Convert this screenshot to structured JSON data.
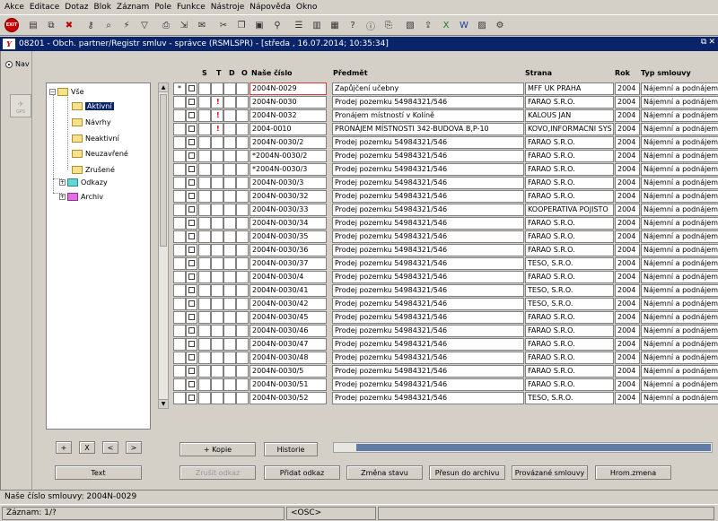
{
  "menu": [
    "Akce",
    "Editace",
    "Dotaz",
    "Blok",
    "Záznam",
    "Pole",
    "Funkce",
    "Nástroje",
    "Nápověda",
    "Okno"
  ],
  "toolbar": {
    "exit_label": "EXIT",
    "icons": [
      "new-record-icon",
      "copy-record-icon",
      "delete-record-icon",
      "key-icon",
      "query-icon",
      "execute-query-icon",
      "filter-icon",
      "print-icon",
      "send-icon",
      "mail-icon",
      "cut-icon",
      "copy-icon",
      "paste-icon",
      "find-icon",
      "list-icon",
      "save-icon",
      "calendar-icon",
      "help-icon",
      "info-icon",
      "attach-icon",
      "report-icon",
      "export-icon",
      "excel-icon",
      "word-icon",
      "chart-icon",
      "config-icon"
    ]
  },
  "window": {
    "title": "08201 - Obch. partner/Registr smluv - správce (RSMLSPR) - [středa , 16.07.2014; 10:35:34]",
    "logo": "Y"
  },
  "left": {
    "nav_label": "Nav",
    "gps_label": "GPS"
  },
  "tree": {
    "root": "Vše",
    "items": [
      "Aktivní",
      "Návrhy",
      "Neaktivní",
      "Neuzavřené",
      "Zrušené",
      "Odkazy",
      "Archiv"
    ]
  },
  "tree_buttons": {
    "add": "+",
    "remove": "X",
    "prev": "<",
    "next": ">",
    "text": "Text"
  },
  "grid": {
    "headers": {
      "s": "S",
      "t": "T",
      "d": "D",
      "o": "O",
      "cislo": "Naše číslo",
      "predmet": "Předmět",
      "strana": "Strana",
      "rok": "Rok",
      "typ": "Typ smlouvy"
    },
    "rows": [
      {
        "marker": "*",
        "t": "",
        "cislo": "2004N-0029",
        "predmet": "Zapůjčení učebny",
        "strana": "MFF UK PRAHA",
        "rok": "2004",
        "typ": "Nájemní a podnájemní"
      },
      {
        "marker": "",
        "t": "!",
        "cislo": "2004N-0030",
        "predmet": "Prodej pozemku 54984321/546",
        "strana": "FARAO S.R.O.",
        "rok": "2004",
        "typ": "Nájemní a podnájemní"
      },
      {
        "marker": "",
        "t": "!",
        "cislo": "2004N-0032",
        "predmet": "Pronájem místností v Kolíně",
        "strana": "KALOUS JAN",
        "rok": "2004",
        "typ": "Nájemní a podnájemní"
      },
      {
        "marker": "",
        "t": "!",
        "cislo": "2004-0010",
        "predmet": "PRONÁJEM MÍSTNOSTI 342-BUDOVA B,P-10",
        "strana": "KOVO,INFORMACNI SYS",
        "rok": "2004",
        "typ": "Nájemní a podnájemní"
      },
      {
        "marker": "",
        "t": "",
        "cislo": "2004N-0030/2",
        "predmet": "Prodej pozemku 54984321/546",
        "strana": "FARAO S.R.O.",
        "rok": "2004",
        "typ": "Nájemní a podnájemní"
      },
      {
        "marker": "",
        "t": "",
        "cislo": "*2004N-0030/2",
        "predmet": "Prodej pozemku 54984321/546",
        "strana": "FARAO S.R.O.",
        "rok": "2004",
        "typ": "Nájemní a podnájemní"
      },
      {
        "marker": "",
        "t": "",
        "cislo": "*2004N-0030/3",
        "predmet": "Prodej pozemku 54984321/546",
        "strana": "FARAO S.R.O.",
        "rok": "2004",
        "typ": "Nájemní a podnájemní"
      },
      {
        "marker": "",
        "t": "",
        "cislo": "2004N-0030/3",
        "predmet": "Prodej pozemku 54984321/546",
        "strana": "FARAO S.R.O.",
        "rok": "2004",
        "typ": "Nájemní a podnájemní"
      },
      {
        "marker": "",
        "t": "",
        "cislo": "2004N-0030/32",
        "predmet": "Prodej pozemku 54984321/546",
        "strana": "FARAO S.R.O.",
        "rok": "2004",
        "typ": "Nájemní a podnájemní"
      },
      {
        "marker": "",
        "t": "",
        "cislo": "2004N-0030/33",
        "predmet": "Prodej pozemku 54984321/546",
        "strana": "KOOPERATIVA POJISTO",
        "rok": "2004",
        "typ": "Nájemní a podnájemní"
      },
      {
        "marker": "",
        "t": "",
        "cislo": "2004N-0030/34",
        "predmet": "Prodej pozemku 54984321/546",
        "strana": "FARAO S.R.O.",
        "rok": "2004",
        "typ": "Nájemní a podnájemní"
      },
      {
        "marker": "",
        "t": "",
        "cislo": "2004N-0030/35",
        "predmet": "Prodej pozemku 54984321/546",
        "strana": "FARAO S.R.O.",
        "rok": "2004",
        "typ": "Nájemní a podnájemní"
      },
      {
        "marker": "",
        "t": "",
        "cislo": "2004N-0030/36",
        "predmet": "Prodej pozemku 54984321/546",
        "strana": "FARAO S.R.O.",
        "rok": "2004",
        "typ": "Nájemní a podnájemní"
      },
      {
        "marker": "",
        "t": "",
        "cislo": "2004N-0030/37",
        "predmet": "Prodej pozemku 54984321/546",
        "strana": "TESO, S.R.O.",
        "rok": "2004",
        "typ": "Nájemní a podnájemní"
      },
      {
        "marker": "",
        "t": "",
        "cislo": "2004N-0030/4",
        "predmet": "Prodej pozemku 54984321/546",
        "strana": "FARAO S.R.O.",
        "rok": "2004",
        "typ": "Nájemní a podnájemní"
      },
      {
        "marker": "",
        "t": "",
        "cislo": "2004N-0030/41",
        "predmet": "Prodej pozemku 54984321/546",
        "strana": "TESO, S.R.O.",
        "rok": "2004",
        "typ": "Nájemní a podnájemní"
      },
      {
        "marker": "",
        "t": "",
        "cislo": "2004N-0030/42",
        "predmet": "Prodej pozemku 54984321/546",
        "strana": "TESO, S.R.O.",
        "rok": "2004",
        "typ": "Nájemní a podnájemní"
      },
      {
        "marker": "",
        "t": "",
        "cislo": "2004N-0030/45",
        "predmet": "Prodej pozemku 54984321/546",
        "strana": "FARAO S.R.O.",
        "rok": "2004",
        "typ": "Nájemní a podnájemní"
      },
      {
        "marker": "",
        "t": "",
        "cislo": "2004N-0030/46",
        "predmet": "Prodej pozemku 54984321/546",
        "strana": "FARAO S.R.O.",
        "rok": "2004",
        "typ": "Nájemní a podnájemní"
      },
      {
        "marker": "",
        "t": "",
        "cislo": "2004N-0030/47",
        "predmet": "Prodej pozemku 54984321/546",
        "strana": "FARAO S.R.O.",
        "rok": "2004",
        "typ": "Nájemní a podnájemní"
      },
      {
        "marker": "",
        "t": "",
        "cislo": "2004N-0030/48",
        "predmet": "Prodej pozemku 54984321/546",
        "strana": "FARAO S.R.O.",
        "rok": "2004",
        "typ": "Nájemní a podnájemní"
      },
      {
        "marker": "",
        "t": "",
        "cislo": "2004N-0030/5",
        "predmet": "Prodej pozemku 54984321/546",
        "strana": "FARAO S.R.O.",
        "rok": "2004",
        "typ": "Nájemní a podnájemní"
      },
      {
        "marker": "",
        "t": "",
        "cislo": "2004N-0030/51",
        "predmet": "Prodej pozemku 54984321/546",
        "strana": "FARAO S.R.O.",
        "rok": "2004",
        "typ": "Nájemní a podnájemní"
      },
      {
        "marker": "",
        "t": "",
        "cislo": "2004N-0030/52",
        "predmet": "Prodej pozemku 54984321/546",
        "strana": "TESO, S.R.O.",
        "rok": "2004",
        "typ": "Nájemní a podnájemní"
      }
    ]
  },
  "buttons": {
    "kopie": "+ Kopie",
    "historie": "Historie",
    "zrusit_odkaz": "Zrušit odkaz",
    "pridat_odkaz": "Přidat odkaz",
    "zmena_stavu": "Změna stavu",
    "presun": "Přesun do archivu",
    "provazane": "Provázané smlouvy",
    "hrom_zmena": "Hrom.zmena"
  },
  "status": {
    "message": "Naše číslo smlouvy: 2004N-0029",
    "record": "Záznam: 1/?",
    "osc": "<OSC>"
  }
}
